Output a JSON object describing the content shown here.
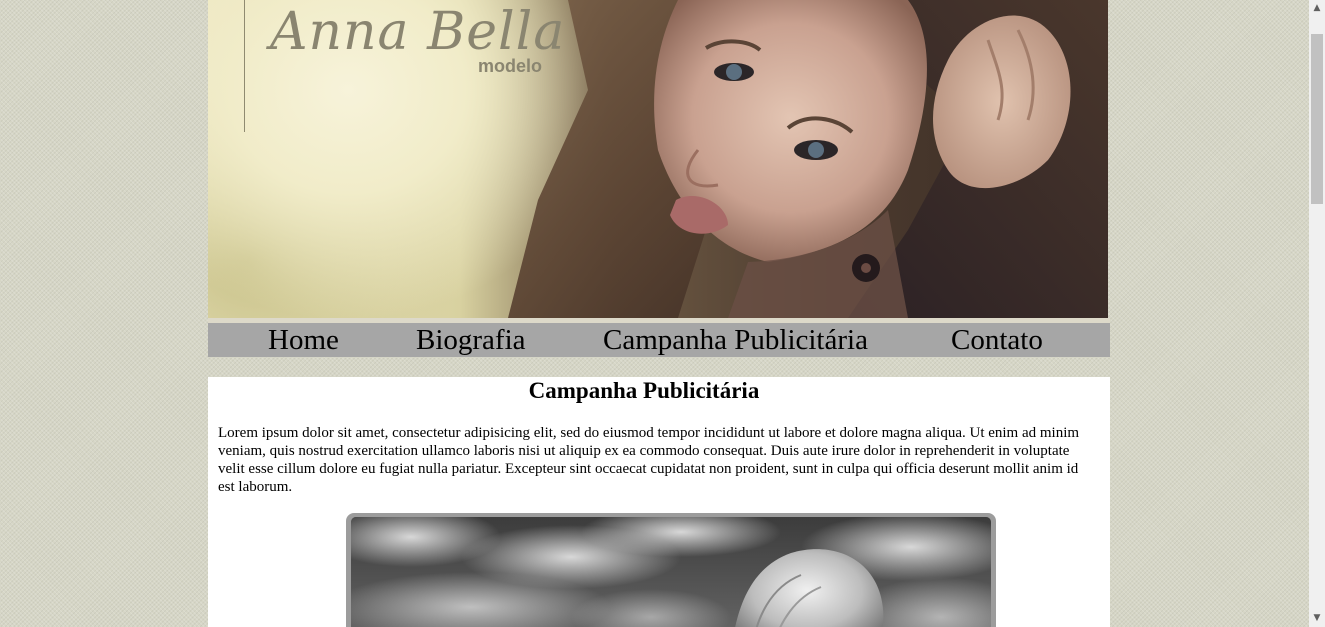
{
  "header": {
    "brand_name": "Anna Bella",
    "brand_subtitle": "modelo"
  },
  "nav": {
    "items": [
      {
        "label": "Home"
      },
      {
        "label": "Biografia"
      },
      {
        "label": "Campanha Publicitária"
      },
      {
        "label": "Contato"
      }
    ]
  },
  "main": {
    "title": "Campanha Publicitária",
    "paragraph": "Lorem ipsum dolor sit amet, consectetur adipisicing elit, sed do eiusmod tempor incididunt ut labore et dolore magna aliqua. Ut enim ad minim veniam, quis nostrud exercitation ullamco laboris nisi ut aliquip ex ea commodo consequat. Duis aute irure dolor in reprehenderit in voluptate velit esse cillum dolore eu fugiat nulla pariatur. Excepteur sint occaecat cupidatat non proident, sunt in culpa qui officia deserunt mollit anim id est laborum."
  },
  "colors": {
    "page_background": "#d6d6c6",
    "nav_background": "#a6a6a6",
    "brand_text": "#8a8570",
    "content_background": "#ffffff",
    "photo_frame": "#9c9c9c"
  },
  "icons": {
    "scroll_up": "scroll-up-arrow-icon",
    "scroll_down": "scroll-down-arrow-icon"
  }
}
